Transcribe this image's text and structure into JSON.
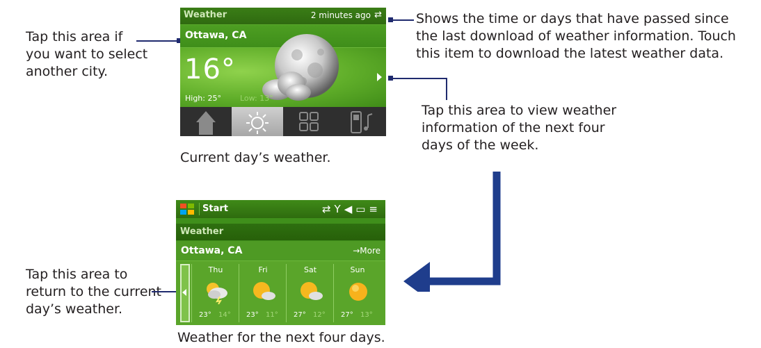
{
  "annotations": {
    "select_city": "Tap this area if\nyou want to select\nanother city.",
    "last_download": "Shows the time or days that have passed since\nthe last download of weather information. Touch\nthis item to download the latest weather data.",
    "next_four_days": "Tap this area to view weather\ninformation of the next four\ndays of the week.",
    "return_current": "Tap this area to\nreturn to the current\nday’s weather."
  },
  "captions": {
    "current": "Current day’s weather.",
    "forecast": "Weather for the next four days."
  },
  "screen_current": {
    "title": "Weather",
    "updated": "2 minutes ago",
    "refresh_icon": "refresh-icon",
    "city": "Ottawa, CA",
    "temperature": "16°",
    "high": "High: 25°",
    "low": "Low: 13°",
    "condition_icons": [
      "moon-icon",
      "cloud-icon"
    ],
    "tabs": [
      "home-icon",
      "sun-icon",
      "grid-icon",
      "music-phone-icon"
    ],
    "selected_tab_index": 1
  },
  "screen_forecast": {
    "start_label": "Start",
    "status_icons": [
      "connectivity-icon",
      "signal-icon",
      "volume-icon",
      "battery-icon",
      "menu-icon"
    ],
    "title": "Weather",
    "city": "Ottawa, CA",
    "more_label": "→More",
    "days": [
      {
        "name": "Thu",
        "hi": "23°",
        "lo": "14°",
        "icon": "sun-cloud-storm-icon"
      },
      {
        "name": "Fri",
        "hi": "23°",
        "lo": "11°",
        "icon": "sun-cloud-icon"
      },
      {
        "name": "Sat",
        "hi": "27°",
        "lo": "12°",
        "icon": "sun-cloud-icon"
      },
      {
        "name": "Sun",
        "hi": "27°",
        "lo": "13°",
        "icon": "sun-icon"
      }
    ]
  },
  "colors": {
    "leader": "#1f2a6e",
    "big_arrow": "#1f3d8c",
    "screen_green": "#4e9a24"
  }
}
